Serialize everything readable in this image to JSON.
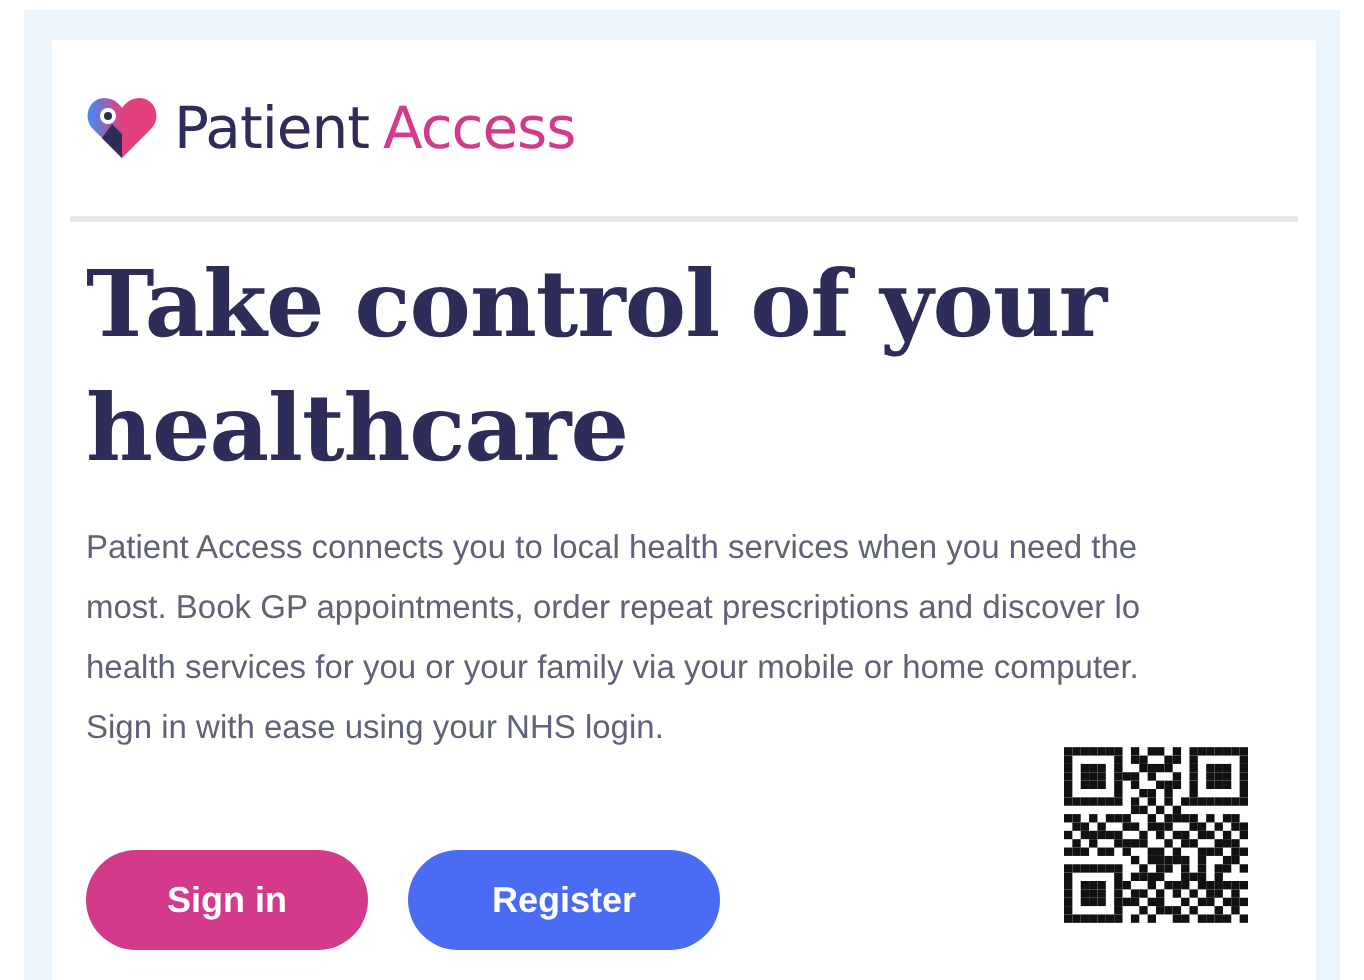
{
  "logo": {
    "word_1": "Patient",
    "word_2": "Access"
  },
  "heading": {
    "lines": [
      "Take control of your",
      "healthcare"
    ]
  },
  "intro": {
    "lines": [
      "Patient Access connects you to local health services when you need the",
      "most. Book GP appointments, order repeat prescriptions and discover lo",
      "health services for you or your family via your mobile or home computer.",
      "Sign in with ease using your NHS login."
    ]
  },
  "buttons": [
    {
      "label": "Sign in",
      "kind": "primary"
    },
    {
      "label": "Register",
      "kind": "secondary"
    }
  ]
}
